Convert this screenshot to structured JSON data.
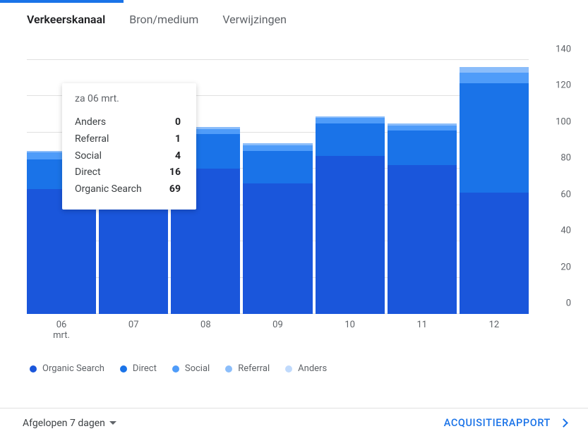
{
  "tabs": [
    {
      "label": "Verkeerskanaal",
      "active": true
    },
    {
      "label": "Bron/medium",
      "active": false
    },
    {
      "label": "Verwijzingen",
      "active": false
    }
  ],
  "legend": [
    {
      "name": "Organic Search",
      "color": "#1a56db"
    },
    {
      "name": "Direct",
      "color": "#1a73e8"
    },
    {
      "name": "Social",
      "color": "#4f9cf9"
    },
    {
      "name": "Referral",
      "color": "#8bbdfa"
    },
    {
      "name": "Anders",
      "color": "#c0dafc"
    }
  ],
  "yAxis": {
    "ticks": [
      0,
      20,
      40,
      60,
      80,
      100,
      120,
      140
    ],
    "max": 140
  },
  "footer": {
    "range_label": "Afgelopen 7 dagen",
    "report_link": "ACQUISITIERAPPORT"
  },
  "tooltip": {
    "title": "za 06 mrt.",
    "rows": [
      {
        "label": "Anders",
        "value": "0"
      },
      {
        "label": "Referral",
        "value": "1"
      },
      {
        "label": "Social",
        "value": "4"
      },
      {
        "label": "Direct",
        "value": "16"
      },
      {
        "label": "Organic Search",
        "value": "69"
      }
    ]
  },
  "chart_data": {
    "type": "bar",
    "stacked": true,
    "ylabel": "",
    "ylim": [
      0,
      140
    ],
    "categories": [
      "06\nmrt.",
      "07",
      "08",
      "09",
      "10",
      "11",
      "12"
    ],
    "series": [
      {
        "name": "Organic Search",
        "color": "#1a56db",
        "values": [
          69,
          79,
          80,
          72,
          87,
          82,
          67
        ]
      },
      {
        "name": "Direct",
        "color": "#1a73e8",
        "values": [
          16,
          15,
          19,
          18,
          18,
          19,
          60
        ]
      },
      {
        "name": "Social",
        "color": "#4f9cf9",
        "values": [
          4,
          4,
          3,
          3,
          3,
          3,
          6
        ]
      },
      {
        "name": "Referral",
        "color": "#8bbdfa",
        "values": [
          1,
          1,
          1,
          1,
          1,
          1,
          3
        ]
      },
      {
        "name": "Anders",
        "color": "#c0dafc",
        "values": [
          0,
          0,
          0,
          0,
          0,
          0,
          0
        ]
      }
    ]
  }
}
